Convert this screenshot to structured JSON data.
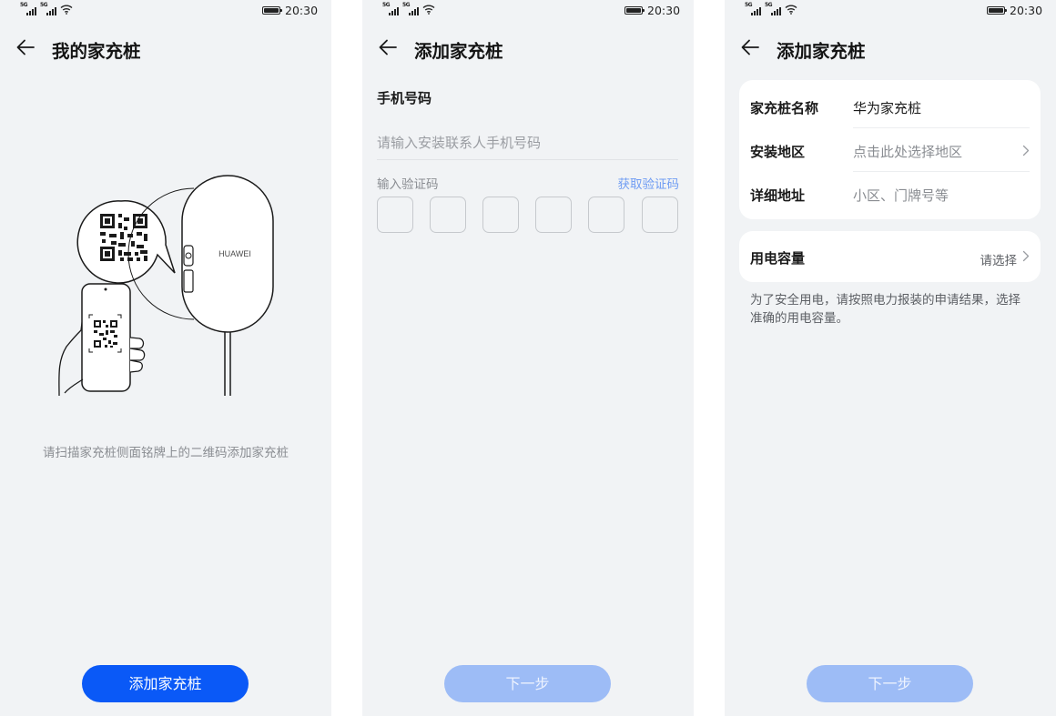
{
  "status_bar": {
    "signal_label_1": "5G",
    "signal_label_2": "5G",
    "time": "20:30"
  },
  "screen1": {
    "title": "我的家充桩",
    "device_brand_label": "HUAWEI",
    "scan_hint": "请扫描家充桩侧面铭牌上的二维码添加家充桩",
    "add_button_label": "添加家充桩"
  },
  "screen2": {
    "title": "添加家充桩",
    "phone_section_label": "手机号码",
    "phone_placeholder": "请输入安装联系人手机号码",
    "code_label": "输入验证码",
    "get_code_label": "获取验证码",
    "code_box_count": 6,
    "next_button_label": "下一步"
  },
  "screen3": {
    "title": "添加家充桩",
    "fields": [
      {
        "label": "家充桩名称",
        "value": "华为家充桩",
        "is_placeholder": false,
        "has_chevron": false
      },
      {
        "label": "安装地区",
        "value": "点击此处选择地区",
        "is_placeholder": true,
        "has_chevron": true
      },
      {
        "label": "详细地址",
        "value": "小区、门牌号等",
        "is_placeholder": true,
        "has_chevron": false
      }
    ],
    "capacity_label": "用电容量",
    "capacity_value": "请选择",
    "note": "为了安全用电，请按照电力报装的申请结果，选择准确的用电容量。",
    "next_button_label": "下一步"
  },
  "icons": [
    "signal-icon",
    "wifi-icon",
    "battery-icon",
    "back-arrow-icon",
    "chevron-right-icon",
    "qr-code-icon",
    "charger-illustration"
  ],
  "colors": {
    "background": "#f1f3f5",
    "primary": "#0a59f7",
    "primary_disabled": "#9dbcf6",
    "link": "#6f9cf3",
    "secondary_text": "#8a8d92"
  }
}
